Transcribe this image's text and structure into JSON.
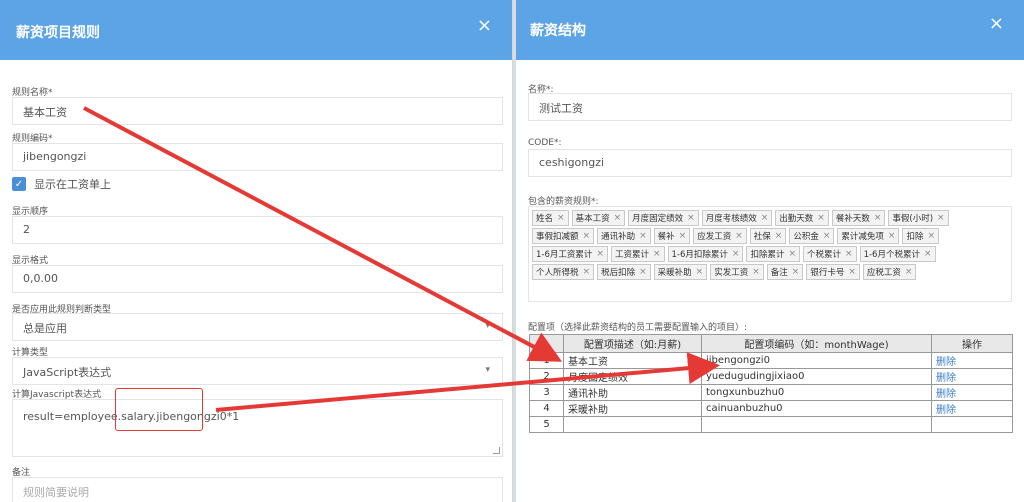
{
  "left_panel": {
    "title": "薪资项目规则",
    "close_icon": "×",
    "fields": {
      "rule_name": {
        "label": "规则名称*",
        "value": "基本工资"
      },
      "rule_code": {
        "label": "规则编码*",
        "value": "jibengongzi"
      },
      "show_on_payslip": {
        "label": "显示在工资单上",
        "checked": true
      },
      "display_order": {
        "label": "显示顺序",
        "value": "2"
      },
      "display_format": {
        "label": "显示格式",
        "value": "0,0.00"
      },
      "apply_rule_type": {
        "label": "是否应用此规则判断类型",
        "value": "总是应用"
      },
      "calc_type": {
        "label": "计算类型",
        "value": "JavaScript表达式"
      },
      "js_expr": {
        "label": "计算Javascript表达式",
        "value": "result=employee.salary.jibengongzi0*1"
      },
      "remark": {
        "label": "备注",
        "placeholder": "规则简要说明"
      }
    }
  },
  "right_panel": {
    "title": "薪资结构",
    "close_icon": "×",
    "name": {
      "label": "名称*:",
      "value": "测试工资"
    },
    "code": {
      "label": "CODE*:",
      "value": "ceshigongzi"
    },
    "rules_label": "包含的薪资规则*:",
    "tag_rows": [
      [
        "姓名",
        "基本工资",
        "月度固定绩效",
        "月度考核绩效",
        "出勤天数",
        "餐补天数",
        "事假(小时)"
      ],
      [
        "事假扣减额",
        "通讯补助",
        "餐补",
        "应发工资",
        "社保",
        "公积金",
        "累计减免项",
        "扣除"
      ],
      [
        "1-6月工资累计",
        "工资累计",
        "1-6月扣除累计",
        "扣除累计",
        "个税累计",
        "1-6月个税累计"
      ],
      [
        "个人所得税",
        "税后扣除",
        "采暖补助",
        "实发工资",
        "备注",
        "银行卡号",
        "应税工资"
      ]
    ],
    "config_title": "配置项（选择此薪资结构的员工需要配置输入的项目）:",
    "table": {
      "headers": [
        "",
        "配置项描述（如:月薪)",
        "配置项编码（如：monthWage)",
        "操作"
      ],
      "rows": [
        {
          "num": "1",
          "desc": "基本工资",
          "code": "jibengongzi0",
          "op": "删除"
        },
        {
          "num": "2",
          "desc": "月度固定绩效",
          "code": "yuedugudingjixiao0",
          "op": "删除"
        },
        {
          "num": "3",
          "desc": "通讯补助",
          "code": "tongxunbuzhu0",
          "op": "删除"
        },
        {
          "num": "4",
          "desc": "采暖补助",
          "code": "cainuanbuzhu0",
          "op": "删除"
        },
        {
          "num": "5",
          "desc": "",
          "code": "",
          "op": ""
        }
      ]
    }
  },
  "annotation_color": "#e53935",
  "header_color": "#5da4e6"
}
